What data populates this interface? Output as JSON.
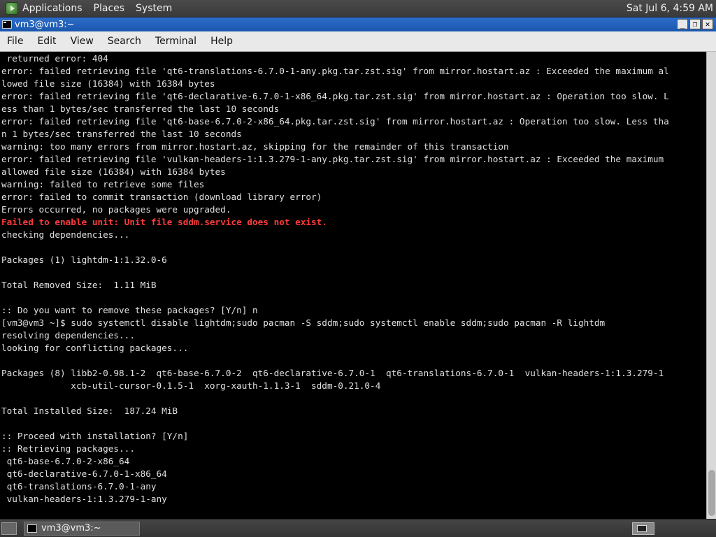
{
  "top_panel": {
    "menus": [
      "Applications",
      "Places",
      "System"
    ],
    "clock": "Sat Jul  6,  4:59 AM"
  },
  "window": {
    "title": "vm3@vm3:~",
    "controls": [
      "_",
      "❐",
      "✕"
    ]
  },
  "menubar": [
    "File",
    "Edit",
    "View",
    "Search",
    "Terminal",
    "Help"
  ],
  "terminal": {
    "lines": [
      {
        "text": " returned error: 404",
        "err": false
      },
      {
        "text": "error: failed retrieving file 'qt6-translations-6.7.0-1-any.pkg.tar.zst.sig' from mirror.hostart.az : Exceeded the maximum al",
        "err": false
      },
      {
        "text": "lowed file size (16384) with 16384 bytes",
        "err": false
      },
      {
        "text": "error: failed retrieving file 'qt6-declarative-6.7.0-1-x86_64.pkg.tar.zst.sig' from mirror.hostart.az : Operation too slow. L",
        "err": false
      },
      {
        "text": "ess than 1 bytes/sec transferred the last 10 seconds",
        "err": false
      },
      {
        "text": "error: failed retrieving file 'qt6-base-6.7.0-2-x86_64.pkg.tar.zst.sig' from mirror.hostart.az : Operation too slow. Less tha",
        "err": false
      },
      {
        "text": "n 1 bytes/sec transferred the last 10 seconds",
        "err": false
      },
      {
        "text": "warning: too many errors from mirror.hostart.az, skipping for the remainder of this transaction",
        "err": false
      },
      {
        "text": "error: failed retrieving file 'vulkan-headers-1:1.3.279-1-any.pkg.tar.zst.sig' from mirror.hostart.az : Exceeded the maximum",
        "err": false
      },
      {
        "text": "allowed file size (16384) with 16384 bytes",
        "err": false
      },
      {
        "text": "warning: failed to retrieve some files",
        "err": false
      },
      {
        "text": "error: failed to commit transaction (download library error)",
        "err": false
      },
      {
        "text": "Errors occurred, no packages were upgraded.",
        "err": false
      },
      {
        "text": "Failed to enable unit: Unit file sddm.service does not exist.",
        "err": true
      },
      {
        "text": "checking dependencies...",
        "err": false
      },
      {
        "text": "",
        "err": false
      },
      {
        "text": "Packages (1) lightdm-1:1.32.0-6",
        "err": false
      },
      {
        "text": "",
        "err": false
      },
      {
        "text": "Total Removed Size:  1.11 MiB",
        "err": false
      },
      {
        "text": "",
        "err": false
      },
      {
        "text": ":: Do you want to remove these packages? [Y/n] n",
        "err": false
      },
      {
        "text": "[vm3@vm3 ~]$ sudo systemctl disable lightdm;sudo pacman -S sddm;sudo systemctl enable sddm;sudo pacman -R lightdm",
        "err": false
      },
      {
        "text": "resolving dependencies...",
        "err": false
      },
      {
        "text": "looking for conflicting packages...",
        "err": false
      },
      {
        "text": "",
        "err": false
      },
      {
        "text": "Packages (8) libb2-0.98.1-2  qt6-base-6.7.0-2  qt6-declarative-6.7.0-1  qt6-translations-6.7.0-1  vulkan-headers-1:1.3.279-1",
        "err": false
      },
      {
        "text": "             xcb-util-cursor-0.1.5-1  xorg-xauth-1.1.3-1  sddm-0.21.0-4",
        "err": false
      },
      {
        "text": "",
        "err": false
      },
      {
        "text": "Total Installed Size:  187.24 MiB",
        "err": false
      },
      {
        "text": "",
        "err": false
      },
      {
        "text": ":: Proceed with installation? [Y/n]",
        "err": false
      },
      {
        "text": ":: Retrieving packages...",
        "err": false
      },
      {
        "text": " qt6-base-6.7.0-2-x86_64",
        "err": false
      },
      {
        "text": " qt6-declarative-6.7.0-1-x86_64",
        "err": false
      },
      {
        "text": " qt6-translations-6.7.0-1-any",
        "err": false
      },
      {
        "text": " vulkan-headers-1:1.3.279-1-any",
        "err": false
      }
    ]
  },
  "taskbar": {
    "task_label": "vm3@vm3:~"
  }
}
